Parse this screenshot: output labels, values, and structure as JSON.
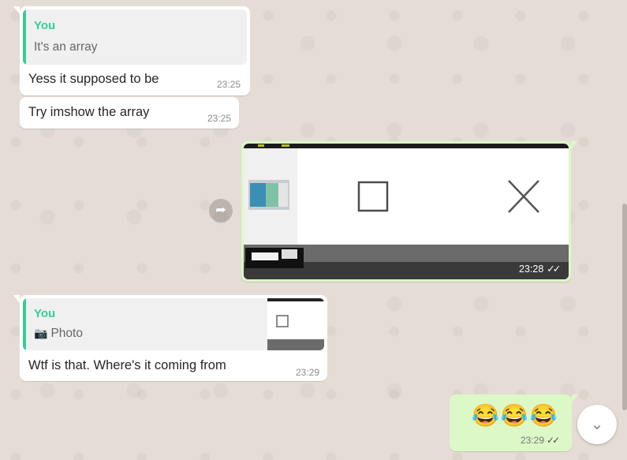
{
  "messages": [
    {
      "quote_author": "You",
      "quote_text": "It's an array",
      "text": "Yess it supposed to be",
      "time": "23:25"
    },
    {
      "text": "Try imshow the array",
      "time": "23:25"
    },
    {
      "time": "23:28",
      "ticks": "✓✓"
    },
    {
      "quote_author": "You",
      "quote_text": "Photo",
      "text": "Wtf is that. Where's it coming from",
      "time": "23:29"
    },
    {
      "emoji": "😂😂😂",
      "time": "23:29",
      "ticks": "✓✓"
    }
  ],
  "colors": {
    "incoming": "#ffffff",
    "outgoing": "#dcf8c6",
    "quote_accent": "#35cd96",
    "wallpaper": "#e5ddd5"
  },
  "icons": {
    "forward": "forward-icon",
    "scroll_down": "chevron-down-icon",
    "photo": "camera-icon"
  }
}
